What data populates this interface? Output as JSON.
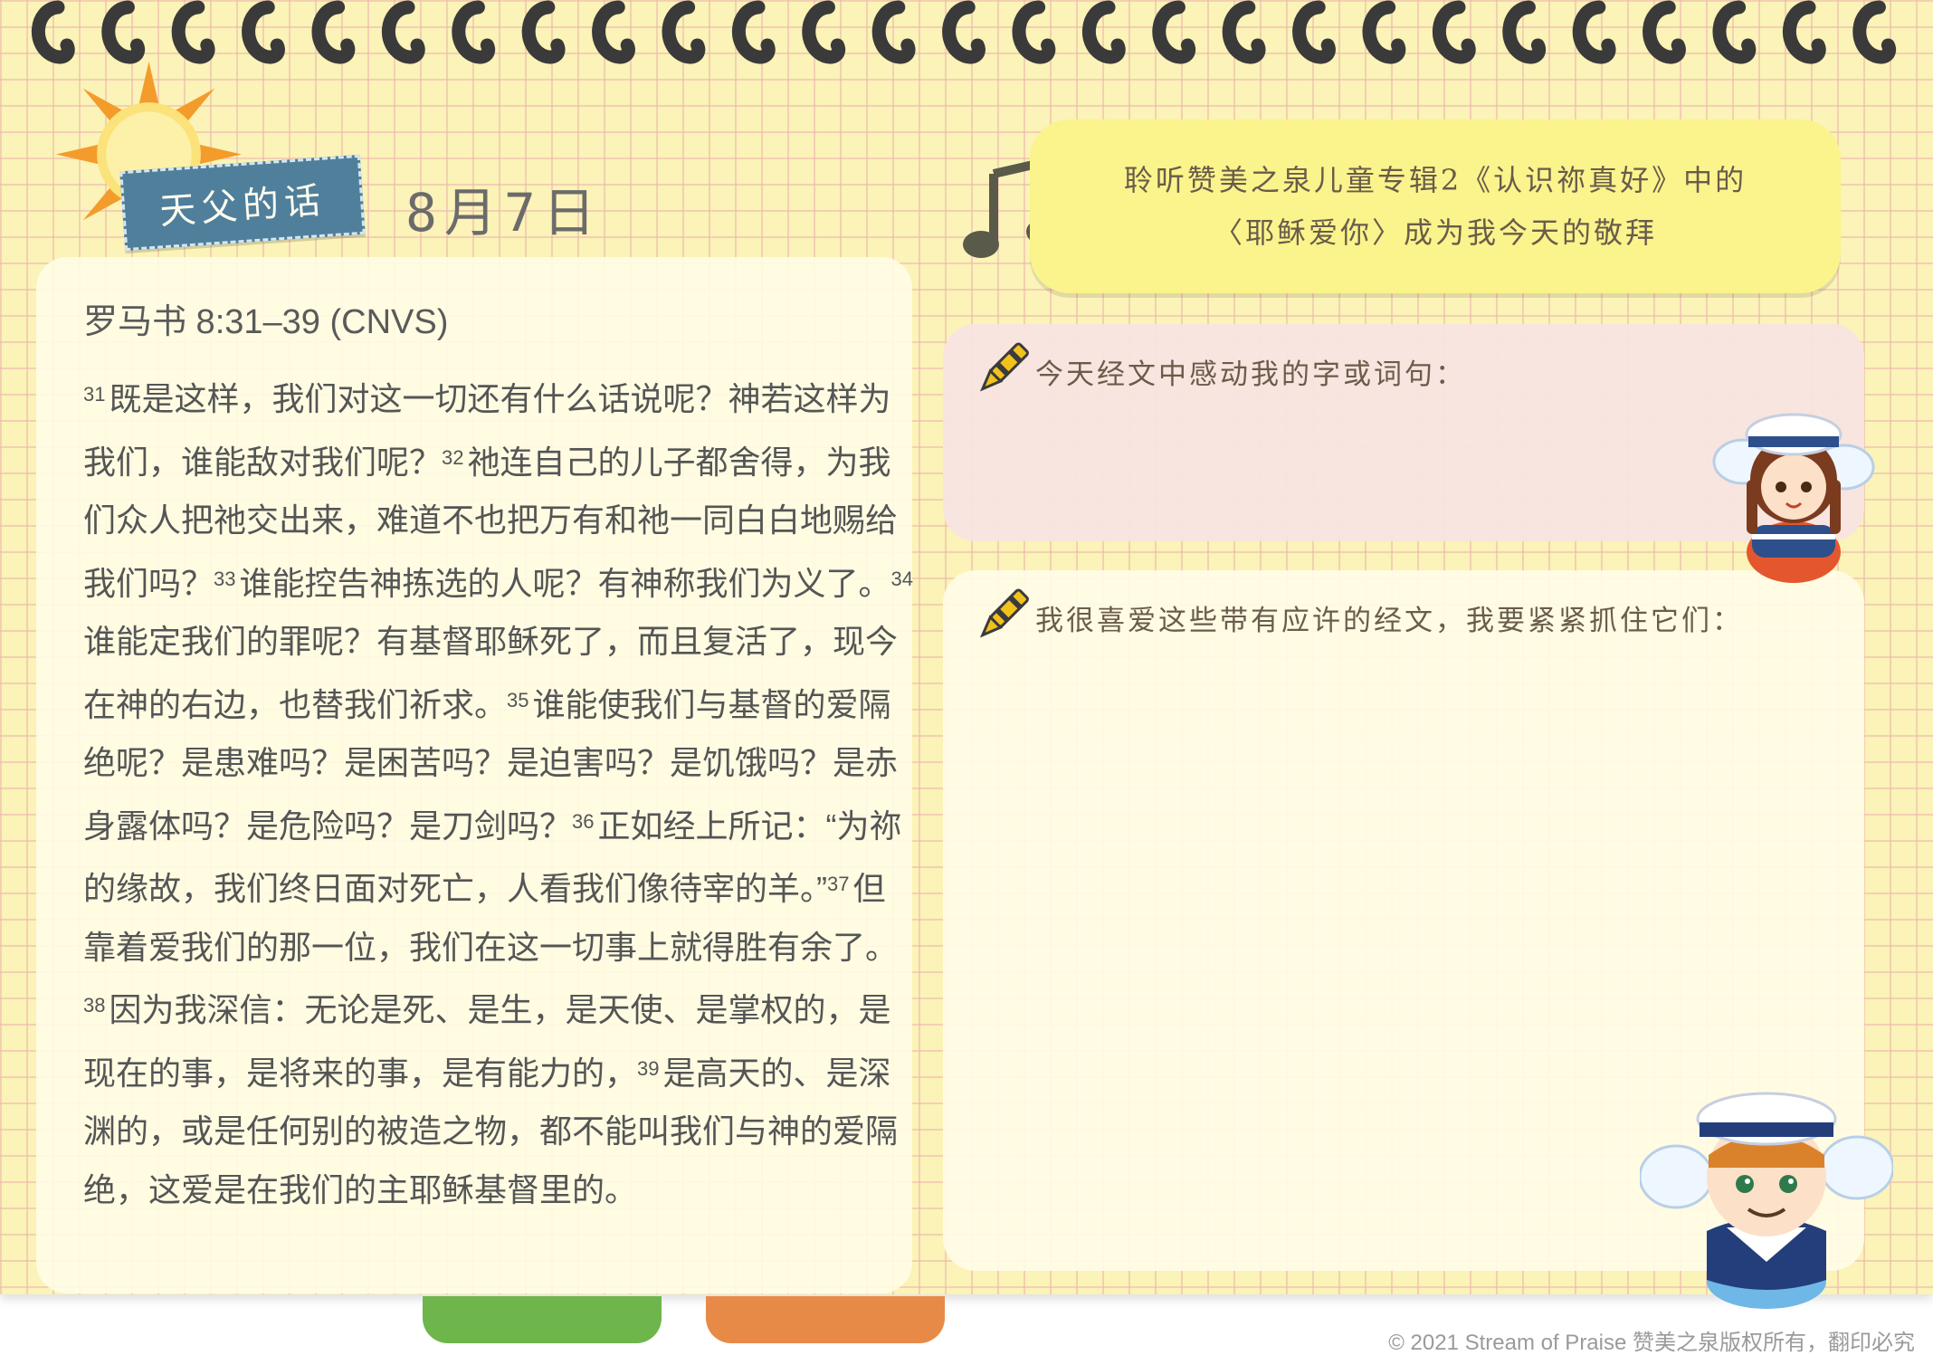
{
  "header": {
    "badge_title": "天父的话",
    "date": "8月7日"
  },
  "scripture": {
    "reference": "罗马书 8:31–39 (CNVS)",
    "verses": [
      {
        "num": "31",
        "text": "既是这样，我们对这一切还有什么话说呢？神若这样为我们，谁能敌对我们呢？"
      },
      {
        "num": "32",
        "text": "祂连自己的儿子都舍得，为我们众人把祂交出来，难道不也把万有和祂一同白白地赐给我们吗？"
      },
      {
        "num": "33",
        "text": "谁能控告神拣选的人呢？有神称我们为义了。"
      },
      {
        "num": "34",
        "text": "谁能定我们的罪呢？有基督耶稣死了，而且复活了，现今在神的右边，也替我们祈求。"
      },
      {
        "num": "35",
        "text": "谁能使我们与基督的爱隔绝呢？是患难吗？是困苦吗？是迫害吗？是饥饿吗？是赤身露体吗？是危险吗？是刀剑吗？"
      },
      {
        "num": "36",
        "text": "正如经上所记：“为祢的缘故，我们终日面对死亡，人看我们像待宰的羊。”"
      },
      {
        "num": "37",
        "text": "但靠着爱我们的那一位，我们在这一切事上就得胜有余了。"
      },
      {
        "num": "38",
        "text": "因为我深信：无论是死、是生，是天使、是掌权的，是现在的事，是将来的事，是有能力的，"
      },
      {
        "num": "39",
        "text": "是高天的、是深渊的，或是任何别的被造之物，都不能叫我们与神的爱隔绝，这爱是在我们的主耶稣基督里的。"
      }
    ]
  },
  "music": {
    "line1": "聆听赞美之泉儿童专辑2《认识祢真好》中的",
    "line2": "〈耶稣爱你〉成为我今天的敬拜"
  },
  "prompts": {
    "touched": "今天经文中感动我的字或词句：",
    "promises": "我很喜爱这些带有应许的经文，我要紧紧抓住它们："
  },
  "footer": {
    "copyright": "© 2021 Stream of Praise 赞美之泉版权所有，翻印必究"
  },
  "colors": {
    "paper": "#fbf3b7",
    "grid": "#ecb2ac",
    "badge": "#4f7f9b",
    "music_card": "#fbf38c",
    "prompt_card": "#f9e4e2",
    "tab_green": "#6eb54b",
    "tab_orange": "#e88a47"
  }
}
